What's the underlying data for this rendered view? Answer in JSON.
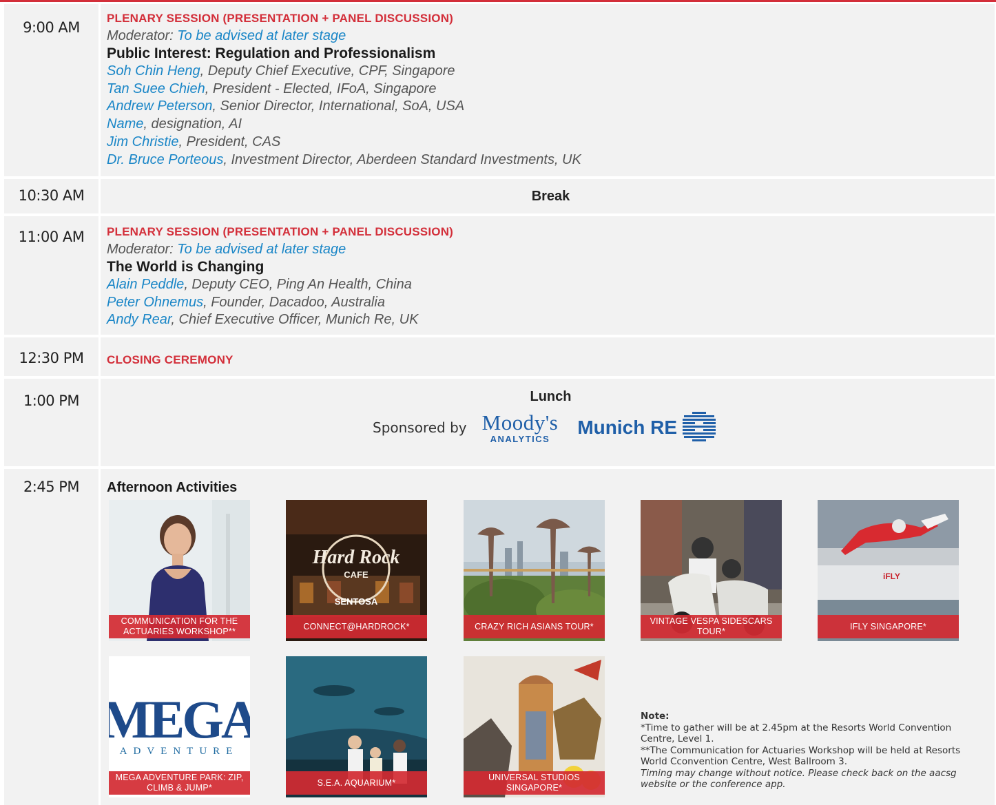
{
  "schedule": [
    {
      "time": "9:00 AM",
      "session": "PLENARY SESSION (PRESENTATION + PANEL DISCUSSION)",
      "moderator_label": "Moderator: ",
      "moderator_value": "To be advised at later stage",
      "title": "Public Interest: Regulation and Professionalism",
      "speakers": [
        {
          "name": "Soh Chin Heng",
          "role": ", Deputy Chief Executive, CPF, Singapore"
        },
        {
          "name": "Tan Suee Chieh",
          "role": ", President - Elected, IFoA, Singapore"
        },
        {
          "name": "Andrew Peterson",
          "role": ", Senior Director, International, SoA, USA"
        },
        {
          "name": "Name",
          "role": ", designation, AI"
        },
        {
          "name": "Jim Christie",
          "role": ", President, CAS"
        },
        {
          "name": "Dr. Bruce Porteous",
          "role": ", Investment Director, Aberdeen Standard Investments, UK"
        }
      ]
    },
    {
      "time": "10:30 AM",
      "label": "Break"
    },
    {
      "time": "11:00 AM",
      "session": "PLENARY SESSION (PRESENTATION + PANEL DISCUSSION)",
      "moderator_label": "Moderator: ",
      "moderator_value": "To be advised at later stage",
      "title": "The World is Changing",
      "speakers": [
        {
          "name": "Alain Peddle",
          "role": ", Deputy CEO, Ping An Health, China"
        },
        {
          "name": "Peter Ohnemus",
          "role": ", Founder, Dacadoo, Australia"
        },
        {
          "name": "Andy Rear",
          "role": ", Chief Executive Officer, Munich Re, UK"
        }
      ]
    },
    {
      "time": "12:30 PM",
      "label": "CLOSING CEREMONY"
    },
    {
      "time": "1:00 PM",
      "label": "Lunch",
      "sponsored_by": "Sponsored by",
      "sponsor1_big": "Moody's",
      "sponsor1_small": "ANALYTICS",
      "sponsor2": "Munich RE"
    },
    {
      "time": "2:45 PM",
      "label": "Afternoon Activities",
      "activities": [
        {
          "caption": "COMMUNICATION FOR THE ACTUARIES WORKSHOP**"
        },
        {
          "caption": "CONNECT@HARDROCK*",
          "sign1": "Hard Rock",
          "sign2": "CAFE",
          "sign3": "SENTOSA"
        },
        {
          "caption": "CRAZY RICH ASIANS TOUR*"
        },
        {
          "caption": "VINTAGE VESPA SIDESCARS TOUR*"
        },
        {
          "caption": "IFLY SINGAPORE*",
          "sign1": "iFLY"
        },
        {
          "caption": "MEGA ADVENTURE PARK: ZIP, CLIMB & JUMP*",
          "sign1": "MEGA",
          "sign2": "ADVENTURE"
        },
        {
          "caption": "S.E.A. AQUARIUM*"
        },
        {
          "caption": "UNIVERSAL STUDIOS SINGAPORE*"
        }
      ]
    }
  ],
  "note": {
    "heading": "Note:",
    "line1": "*Time to gather will be at 2.45pm at the Resorts World Convention Centre, Level 1.",
    "line2": "**The Communication for Actuaries Workshop will be held at Resorts World Cconvention Centre, West Ballroom 3.",
    "line3": "Timing may change without notice. Please check back on the aacsg website or the conference app."
  },
  "colors": {
    "accent": "#d32f3a",
    "link": "#1a86c7",
    "row_bg": "#f2f2f2"
  }
}
